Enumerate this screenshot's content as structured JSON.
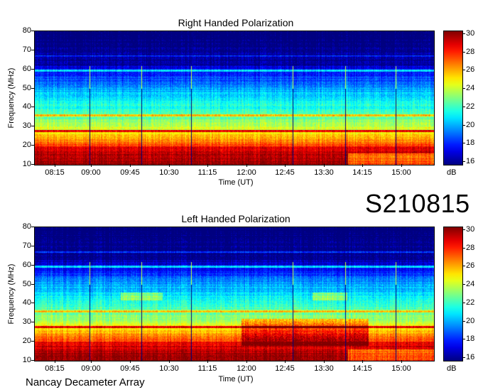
{
  "big_label": "S210815",
  "footer": "Nancay Decameter Array",
  "chart_data": [
    {
      "type": "heatmap",
      "title": "Right Handed Polarization",
      "xlabel": "Time (UT)",
      "ylabel": "Frequency (MHz)",
      "x_ticks": [
        "08:15",
        "09:00",
        "09:45",
        "10:30",
        "11:15",
        "12:00",
        "12:45",
        "13:30",
        "14:15",
        "15:00"
      ],
      "y_ticks": [
        "80",
        "70",
        "60",
        "50",
        "40",
        "30",
        "20",
        "10"
      ],
      "ylim": [
        10,
        80
      ],
      "colorbar": {
        "ticks": [
          "30",
          "28",
          "26",
          "24",
          "22",
          "20",
          "18",
          "16"
        ],
        "range": [
          16,
          30
        ],
        "unit": "dB"
      }
    },
    {
      "type": "heatmap",
      "title": "Left Handed Polarization",
      "xlabel": "Time (UT)",
      "ylabel": "Frequency (MHz)",
      "x_ticks": [
        "08:15",
        "09:00",
        "09:45",
        "10:30",
        "11:15",
        "12:00",
        "12:45",
        "13:30",
        "14:15",
        "15:00"
      ],
      "y_ticks": [
        "80",
        "70",
        "60",
        "50",
        "40",
        "30",
        "20",
        "10"
      ],
      "ylim": [
        10,
        80
      ],
      "colorbar": {
        "ticks": [
          "30",
          "28",
          "26",
          "24",
          "22",
          "20",
          "18",
          "16"
        ],
        "range": [
          16,
          30
        ],
        "unit": "dB"
      }
    }
  ]
}
